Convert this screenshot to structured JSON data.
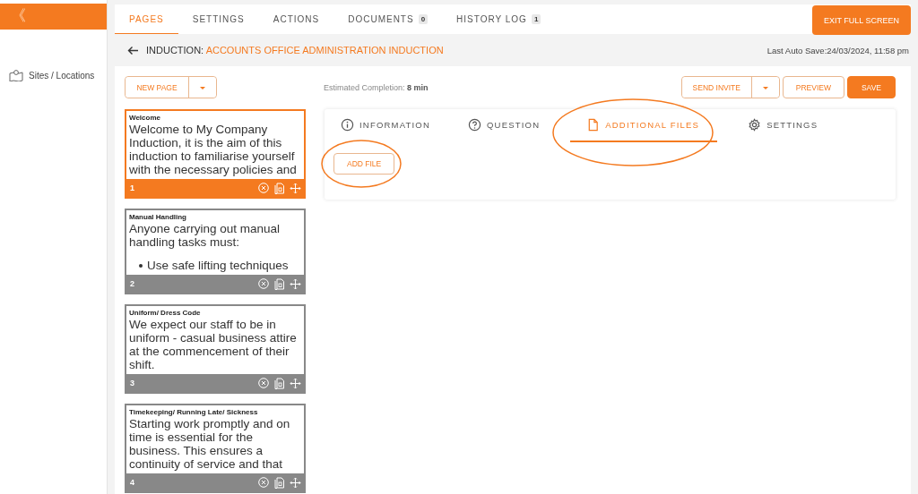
{
  "sidebar": {
    "collapse_glyph": "《",
    "items": [
      {
        "label": "Sites / Locations"
      }
    ]
  },
  "top_tabs": [
    {
      "label": "PAGES",
      "selected": true
    },
    {
      "label": "SETTINGS",
      "selected": false
    },
    {
      "label": "ACTIONS",
      "selected": false
    },
    {
      "label": "DOCUMENTS",
      "badge": "0",
      "selected": false
    },
    {
      "label": "HISTORY LOG",
      "badge": "1",
      "selected": false
    }
  ],
  "exit_button": "EXIT FULL SCREEN",
  "header": {
    "prefix": "INDUCTION:",
    "title": "ACCOUNTS OFFICE ADMINISTRATION INDUCTION",
    "autosave": "Last Auto Save:24/03/2024, 11:58 pm"
  },
  "toolbar": {
    "new_page": "NEW PAGE",
    "estimate_label": "Estimated Completion:",
    "estimate_value": "8 min",
    "send_invite": "SEND INVITE",
    "preview": "PREVIEW",
    "save": "SAVE"
  },
  "pages": [
    {
      "title": "Welcome",
      "number": "1",
      "selected": true,
      "blocks": [
        {
          "kind": "p",
          "text": "Welcome to My Company Induction, it is the aim of this induction to familiarise yourself with the necessary policies and"
        }
      ]
    },
    {
      "title": "Manual Handling",
      "number": "2",
      "selected": false,
      "blocks": [
        {
          "kind": "p",
          "text": "Anyone carrying out manual handling tasks must:"
        },
        {
          "kind": "bullet",
          "text": "Use safe lifting techniques"
        }
      ]
    },
    {
      "title": "Uniform/ Dress Code",
      "number": "3",
      "selected": false,
      "blocks": [
        {
          "kind": "p",
          "text": "We expect our staff to be in uniform - casual business attire at the commencement of their shift."
        }
      ]
    },
    {
      "title": "Timekeeping/ Running Late/ Sickness",
      "number": "4",
      "selected": false,
      "blocks": [
        {
          "kind": "p",
          "text": "Starting work promptly and on time is essential for the business. This ensures a continuity of service and that"
        }
      ]
    }
  ],
  "editor": {
    "tabs": [
      {
        "label": "INFORMATION",
        "selected": false,
        "highlighted": false
      },
      {
        "label": "QUESTION",
        "selected": false,
        "highlighted": false
      },
      {
        "label": "ADDITIONAL FILES",
        "selected": true,
        "highlighted": true
      },
      {
        "label": "SETTINGS",
        "selected": false,
        "highlighted": false
      }
    ],
    "add_file": {
      "label": "ADD FILE",
      "highlighted": true
    }
  }
}
